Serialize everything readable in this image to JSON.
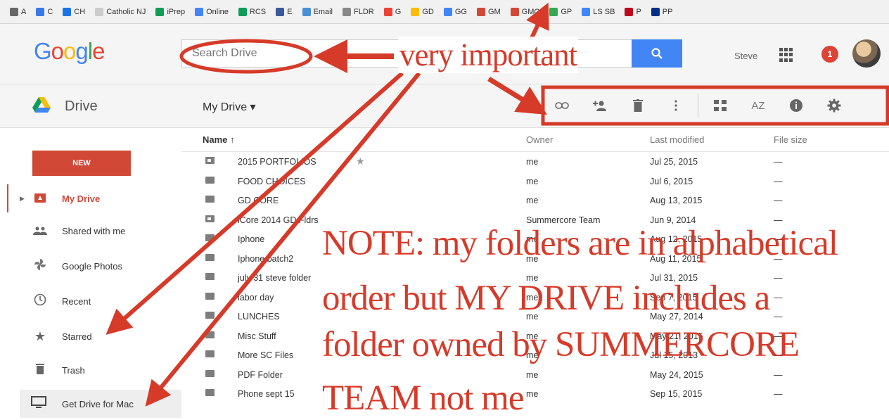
{
  "bookmarks": [
    {
      "label": "A",
      "color": "#666666"
    },
    {
      "label": "C",
      "color": "#3b78e7"
    },
    {
      "label": "CH",
      "color": "#1a73e8"
    },
    {
      "label": "Catholic NJ",
      "color": "#cccccc"
    },
    {
      "label": "iPrep",
      "color": "#0f9d58"
    },
    {
      "label": "Online",
      "color": "#4285f4"
    },
    {
      "label": "RCS",
      "color": "#0f9d58"
    },
    {
      "label": "E",
      "color": "#3b5998"
    },
    {
      "label": "Email",
      "color": "#4a90d9"
    },
    {
      "label": "FLDR",
      "color": "#888888"
    },
    {
      "label": "G",
      "color": "#ea4335"
    },
    {
      "label": "GD",
      "color": "#fbbc05"
    },
    {
      "label": "GG",
      "color": "#4285f4"
    },
    {
      "label": "GM",
      "color": "#d14836"
    },
    {
      "label": "GMC",
      "color": "#d14836"
    },
    {
      "label": "GP",
      "color": "#34a853"
    },
    {
      "label": "LS SB",
      "color": "#4285f4"
    },
    {
      "label": "P",
      "color": "#bd081c"
    },
    {
      "label": "PP",
      "color": "#003087"
    }
  ],
  "header": {
    "logo_letters": [
      {
        "ch": "G",
        "color": "#4285f4"
      },
      {
        "ch": "o",
        "color": "#ea4335"
      },
      {
        "ch": "o",
        "color": "#fbbc05"
      },
      {
        "ch": "g",
        "color": "#4285f4"
      },
      {
        "ch": "l",
        "color": "#34a853"
      },
      {
        "ch": "e",
        "color": "#ea4335"
      }
    ],
    "search_placeholder": "Search Drive",
    "user_name": "Steve",
    "notification_count": "1"
  },
  "drivebar": {
    "product": "Drive",
    "location": "My Drive ▾",
    "toolbar_icons": [
      "get-link-icon",
      "share-icon",
      "trash-icon",
      "more-icon",
      "grid-view-icon",
      "sort-icon",
      "info-icon",
      "settings-icon"
    ]
  },
  "sidebar": {
    "new_label": "NEW",
    "items": [
      {
        "label": "My Drive",
        "icon": "drive-icon",
        "active": true
      },
      {
        "label": "Shared with me",
        "icon": "people-icon"
      },
      {
        "label": "Google Photos",
        "icon": "photos-icon"
      },
      {
        "label": "Recent",
        "icon": "clock-icon"
      },
      {
        "label": "Starred",
        "icon": "star-icon"
      },
      {
        "label": "Trash",
        "icon": "trash-icon"
      },
      {
        "label": "Get Drive for Mac",
        "icon": "computer-icon"
      }
    ]
  },
  "list": {
    "columns": {
      "name": "Name ↑",
      "owner": "Owner",
      "modified": "Last modified",
      "size": "File size"
    },
    "rows": [
      {
        "name": "2015 PORTFOLIOS",
        "owner": "me",
        "modified": "Jul 25, 2015",
        "size": "—",
        "shared": true,
        "starred": true
      },
      {
        "name": "FOOD CHOICES",
        "owner": "me",
        "modified": "Jul 6, 2015",
        "size": "—"
      },
      {
        "name": "GD CORE",
        "owner": "me",
        "modified": "Aug 13, 2015",
        "size": "—"
      },
      {
        "name": "iCore 2014 GD Fldrs",
        "owner": "Summercore Team",
        "modified": "Jun 9, 2014",
        "size": "—",
        "shared": true
      },
      {
        "name": "Iphone",
        "owner": "me",
        "modified": "Aug 12, 2015",
        "size": "—"
      },
      {
        "name": "Iphone batch2",
        "owner": "me",
        "modified": "Aug 11, 2015",
        "size": "—"
      },
      {
        "name": "july 31 steve folder",
        "owner": "me",
        "modified": "Jul 31, 2015",
        "size": "—"
      },
      {
        "name": "labor day",
        "owner": "me",
        "modified": "Sep 7, 2015",
        "size": "—"
      },
      {
        "name": "LUNCHES",
        "owner": "me",
        "modified": "May 27, 2014",
        "size": "—"
      },
      {
        "name": "Misc Stuff",
        "owner": "me",
        "modified": "May 21, 2015",
        "size": "—"
      },
      {
        "name": "More SC Files",
        "owner": "me",
        "modified": "Jul 15, 2013",
        "size": "—"
      },
      {
        "name": "PDF Folder",
        "owner": "me",
        "modified": "May 24, 2015",
        "size": "—"
      },
      {
        "name": "Phone sept 15",
        "owner": "me",
        "modified": "Sep 15, 2015",
        "size": "—"
      }
    ]
  },
  "annotations": {
    "headline": "very important",
    "note_lines": [
      "NOTE: my folders are in alphabetical",
      "order but MY DRIVE includes a",
      "folder owned by SUMMERCORE",
      "TEAM not me"
    ],
    "color": "#d63a29"
  }
}
